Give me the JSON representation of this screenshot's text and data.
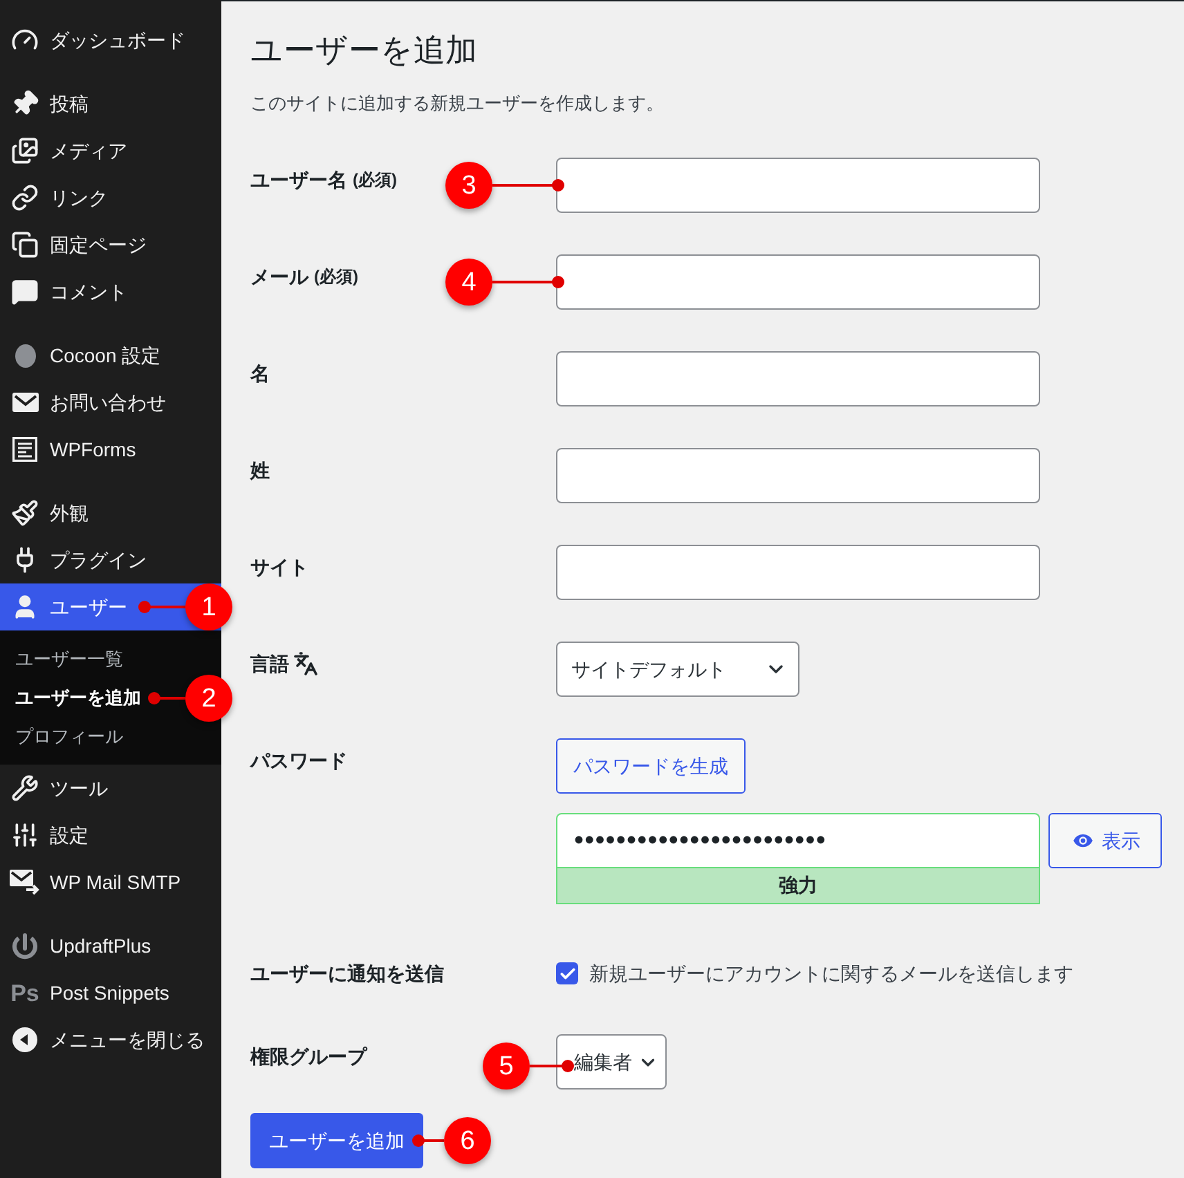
{
  "sidebar": {
    "groups": [
      {
        "items": [
          {
            "label": "ダッシュボード",
            "selected": false
          }
        ]
      },
      {
        "items": [
          {
            "label": "投稿",
            "selected": false
          },
          {
            "label": "メディア",
            "selected": false
          },
          {
            "label": "リンク",
            "selected": false
          },
          {
            "label": "固定ページ",
            "selected": false
          },
          {
            "label": "コメント",
            "selected": false
          }
        ]
      },
      {
        "items": [
          {
            "label": "Cocoon 設定",
            "selected": false
          },
          {
            "label": "お問い合わせ",
            "selected": false
          },
          {
            "label": "WPForms",
            "selected": false
          }
        ]
      },
      {
        "items": [
          {
            "label": "外観",
            "selected": false
          },
          {
            "label": "プラグイン",
            "selected": false
          },
          {
            "label": "ユーザー",
            "selected": true,
            "callout": "1",
            "children": [
              {
                "label": "ユーザー一覧",
                "selected": false
              },
              {
                "label": "ユーザーを追加",
                "selected": true,
                "callout": "2"
              },
              {
                "label": "プロフィール",
                "selected": false
              }
            ]
          },
          {
            "label": "ツール",
            "selected": false
          },
          {
            "label": "設定",
            "selected": false
          },
          {
            "label": "WP Mail SMTP",
            "selected": false
          }
        ]
      },
      {
        "items": [
          {
            "label": "UpdraftPlus",
            "selected": false
          },
          {
            "label": "Post Snippets",
            "selected": false,
            "icon_text": "Ps"
          },
          {
            "label": "メニューを閉じる",
            "selected": false
          }
        ]
      }
    ]
  },
  "page": {
    "title": "ユーザーを追加",
    "description": "このサイトに追加する新規ユーザーを作成します。"
  },
  "form": {
    "rows": [
      {
        "kind": "text",
        "label": "ユーザー名",
        "note": "(必須)",
        "callout": "3"
      },
      {
        "kind": "text",
        "label": "メール",
        "note": "(必須)",
        "callout": "4"
      },
      {
        "kind": "text",
        "label": "名"
      },
      {
        "kind": "text",
        "label": "姓"
      },
      {
        "kind": "text",
        "label": "サイト"
      },
      {
        "kind": "language",
        "label": "言語",
        "value": "サイトデフォルト"
      },
      {
        "kind": "password",
        "label": "パスワード",
        "generate_button": "パスワードを生成",
        "value": "••••••••••••••••••••••••",
        "strong": true,
        "strength_label": "強力",
        "toggle_button": "表示"
      },
      {
        "kind": "checkbox",
        "label": "ユーザーに通知を送信",
        "checked": true,
        "text": "新規ユーザーにアカウントに関するメールを送信します"
      },
      {
        "kind": "select",
        "label": "権限グループ",
        "value": "編集者",
        "callout": "5"
      }
    ]
  },
  "submit": {
    "label": "ユーザーを追加",
    "callout": "6"
  }
}
